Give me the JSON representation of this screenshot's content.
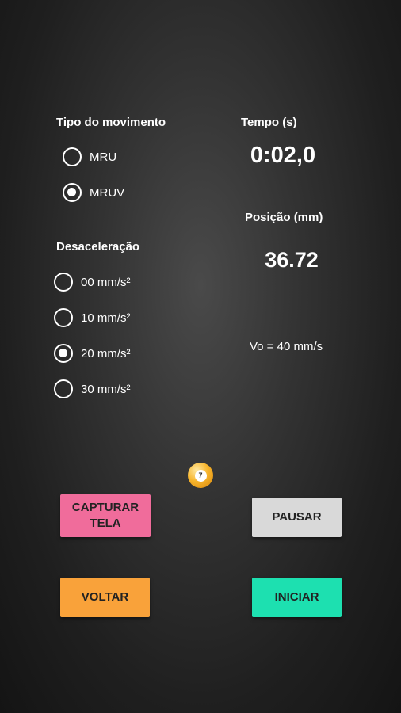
{
  "movement": {
    "title": "Tipo do movimento",
    "options": [
      {
        "label": "MRU",
        "checked": false
      },
      {
        "label": "MRUV",
        "checked": true
      }
    ]
  },
  "time": {
    "title": "Tempo (s)",
    "value": "0:02,0"
  },
  "position": {
    "title": "Posição (mm)",
    "value": "36.72"
  },
  "deceleration": {
    "title": "Desaceleração",
    "options": [
      {
        "label": "00 mm/s²",
        "checked": false
      },
      {
        "label": "10 mm/s²",
        "checked": false
      },
      {
        "label": "20 mm/s²",
        "checked": true
      },
      {
        "label": "30 mm/s²",
        "checked": false
      }
    ]
  },
  "initial_velocity": "Vo = 40 mm/s",
  "ball": {
    "number": "7"
  },
  "buttons": {
    "capture": {
      "label_line1": "CAPTURAR",
      "label_line2": "TELA",
      "color": "#f06c9b"
    },
    "pause": {
      "label": "PAUSAR",
      "color": "#d9d9d9"
    },
    "back": {
      "label": "VOLTAR",
      "color": "#f9a23a"
    },
    "start": {
      "label": "INICIAR",
      "color": "#1de0b0"
    }
  }
}
